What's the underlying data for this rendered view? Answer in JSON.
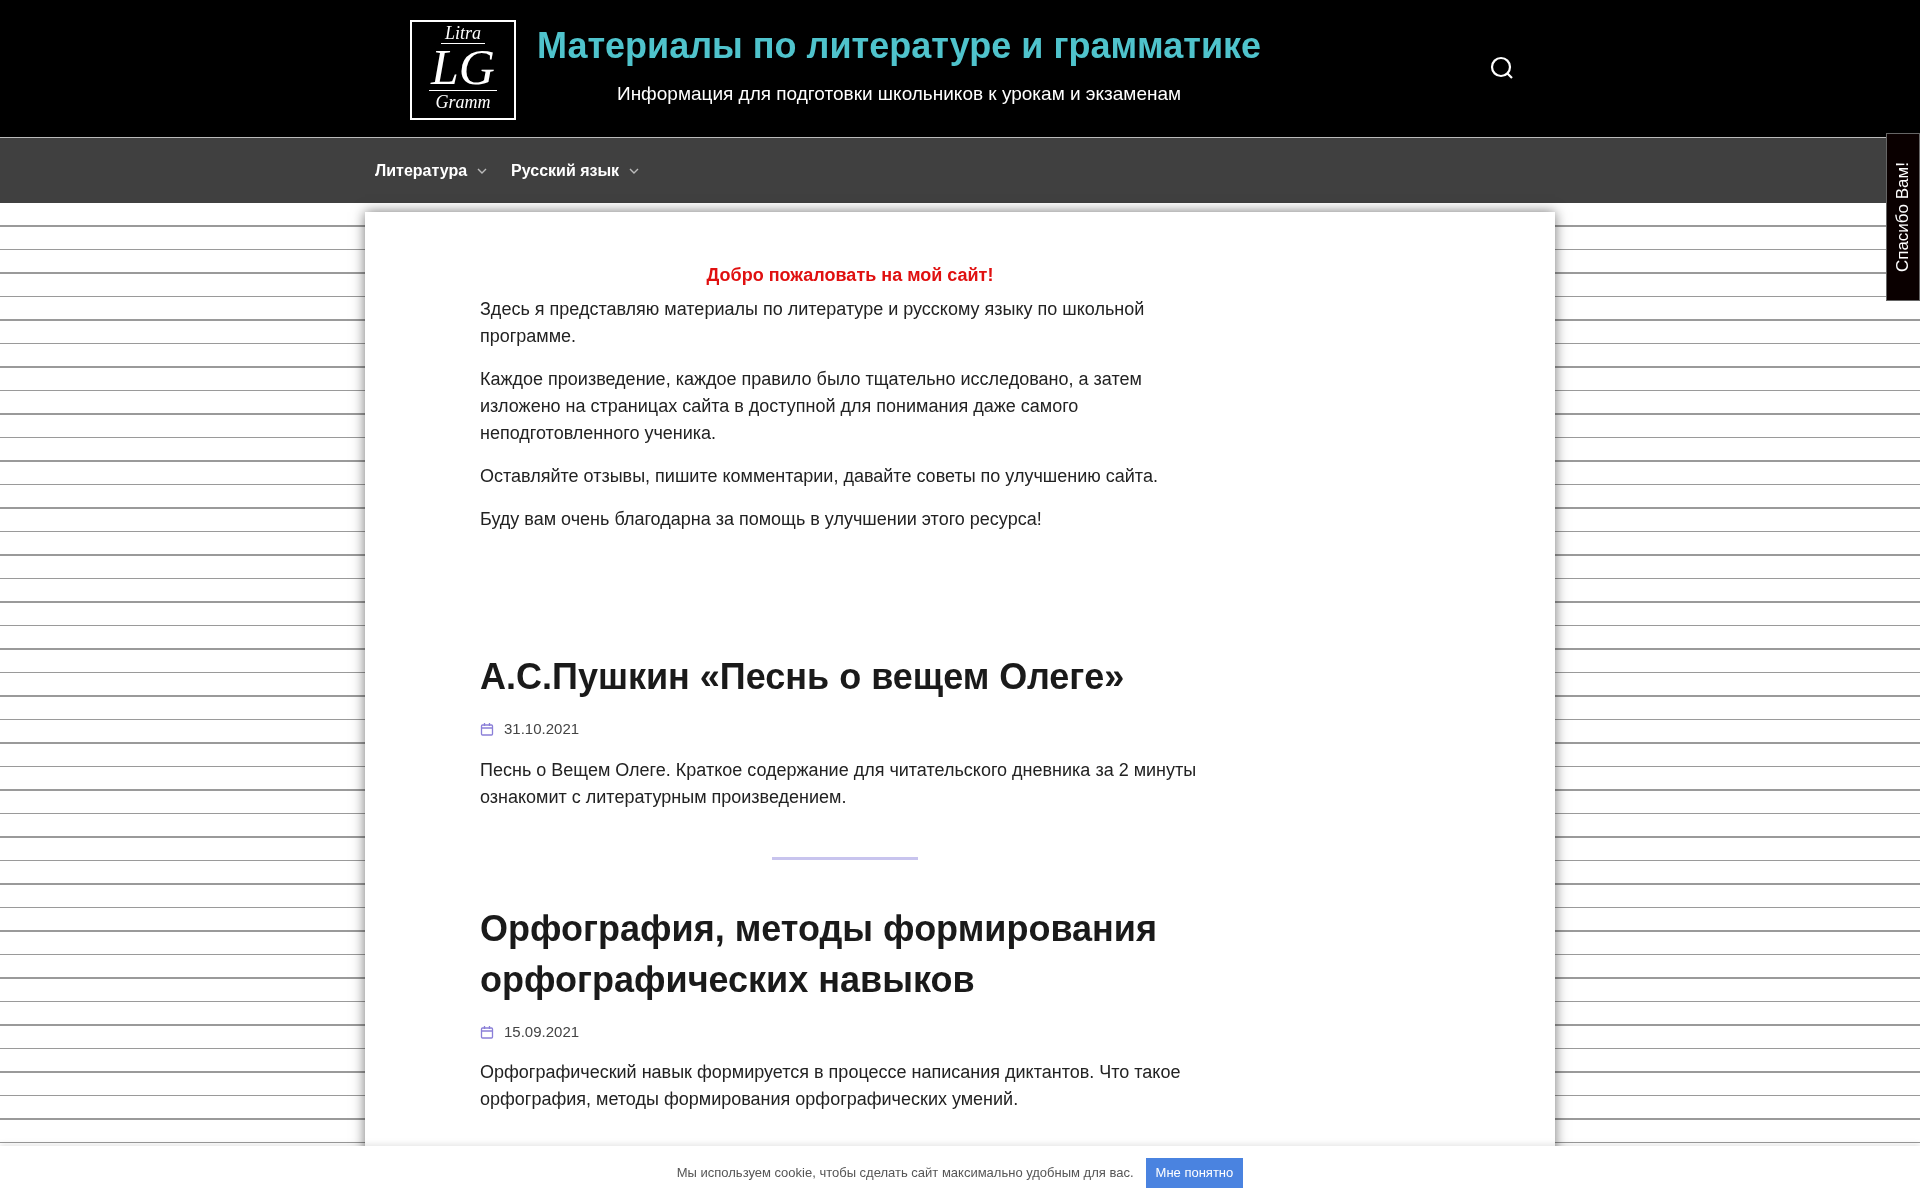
{
  "header": {
    "logo": {
      "top": "Litra",
      "middle": "LG",
      "bottom": "Gramm"
    },
    "title": "Материалы по литературе и грамматике",
    "subtitle": "Информация для подготовки школьников к урокам и экзаменам"
  },
  "nav": [
    {
      "label": "Литература",
      "has_dropdown": true
    },
    {
      "label": "Русский язык",
      "has_dropdown": true
    }
  ],
  "side_tab": "Спасибо Вам!",
  "welcome": {
    "heading": "Добро пожаловать на мой сайт!",
    "paragraphs": [
      "Здесь я представляю материалы по литературе и русскому языку по школьной программе.",
      "Каждое произведение, каждое правило было тщательно исследовано, а затем изложено на страницах сайта в доступной для понимания даже самого неподготовленного ученика.",
      "Оставляйте отзывы, пишите комментарии, давайте советы по улучшению сайта.",
      "Буду вам очень благодарна за помощь в улучшении этого ресурса!"
    ]
  },
  "posts": [
    {
      "title": "А.С.Пушкин «Песнь о вещем Олеге»",
      "date": "31.10.2021",
      "excerpt": "Песнь о Вещем Олеге. Краткое содержание для читательского дневника за 2 минуты ознакомит с литературным произведением."
    },
    {
      "title": "Орфография, методы формирования орфографических навыков",
      "date": "15.09.2021",
      "excerpt": "Орфографический навык формируется в процессе написания диктантов. Что такое орфография, методы формирования орфографических умений."
    }
  ],
  "cookie_bar": {
    "text": "Мы используем cookie, чтобы сделать сайт максимально удобным для вас.",
    "button": "Мне понятно"
  }
}
